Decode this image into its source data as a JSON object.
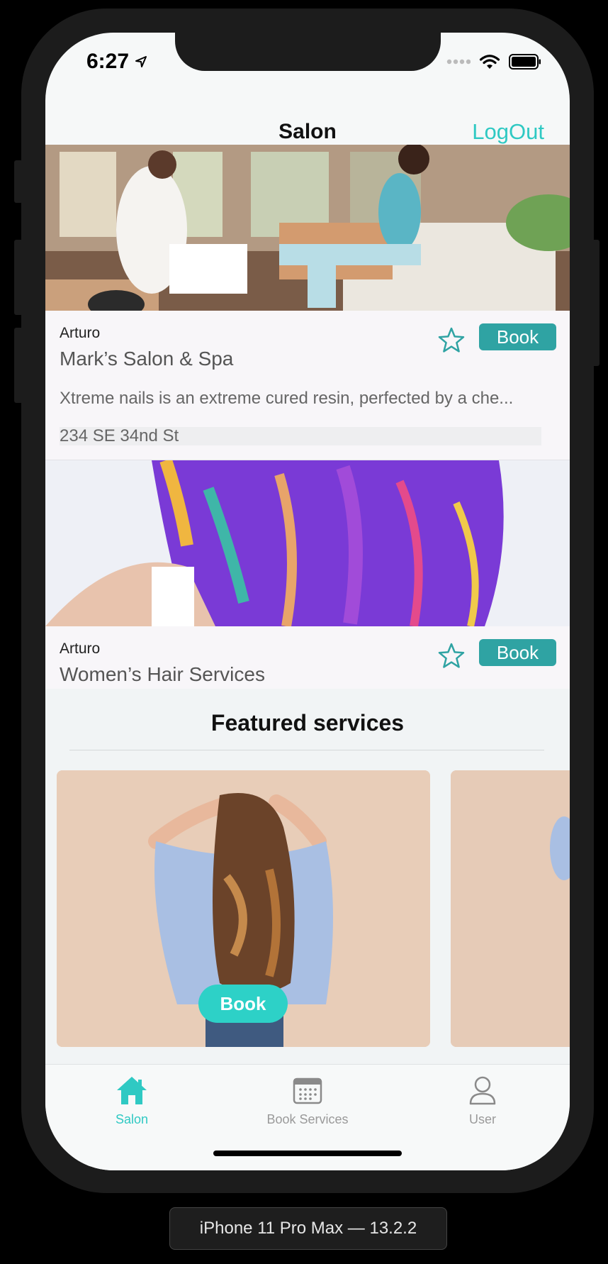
{
  "status_bar": {
    "time": "6:27"
  },
  "nav": {
    "title": "Salon",
    "logout_label": "LogOut"
  },
  "salons": [
    {
      "owner": "Arturo",
      "name": "Mark’s Salon & Spa",
      "description": "Xtreme nails is an extreme cured resin, perfected by a che...",
      "address": "234 SE 34nd St",
      "book_label": "Book"
    },
    {
      "owner": "Arturo",
      "name": "Women’s Hair Services",
      "book_label": "Book"
    }
  ],
  "featured": {
    "title": "Featured services",
    "book_label": "Book"
  },
  "tabs": [
    {
      "label": "Salon",
      "icon": "home-icon",
      "active": true
    },
    {
      "label": "Book Services",
      "icon": "calendar-icon",
      "active": false
    },
    {
      "label": "User",
      "icon": "user-icon",
      "active": false
    }
  ],
  "device_label": "iPhone 11 Pro Max — 13.2.2",
  "colors": {
    "accent": "#2fc9c3",
    "book_button": "#2fa3a3",
    "book_pill": "#2dd1c7",
    "tab_active": "#2fc9c3",
    "tab_inactive": "#9a9a9a"
  }
}
